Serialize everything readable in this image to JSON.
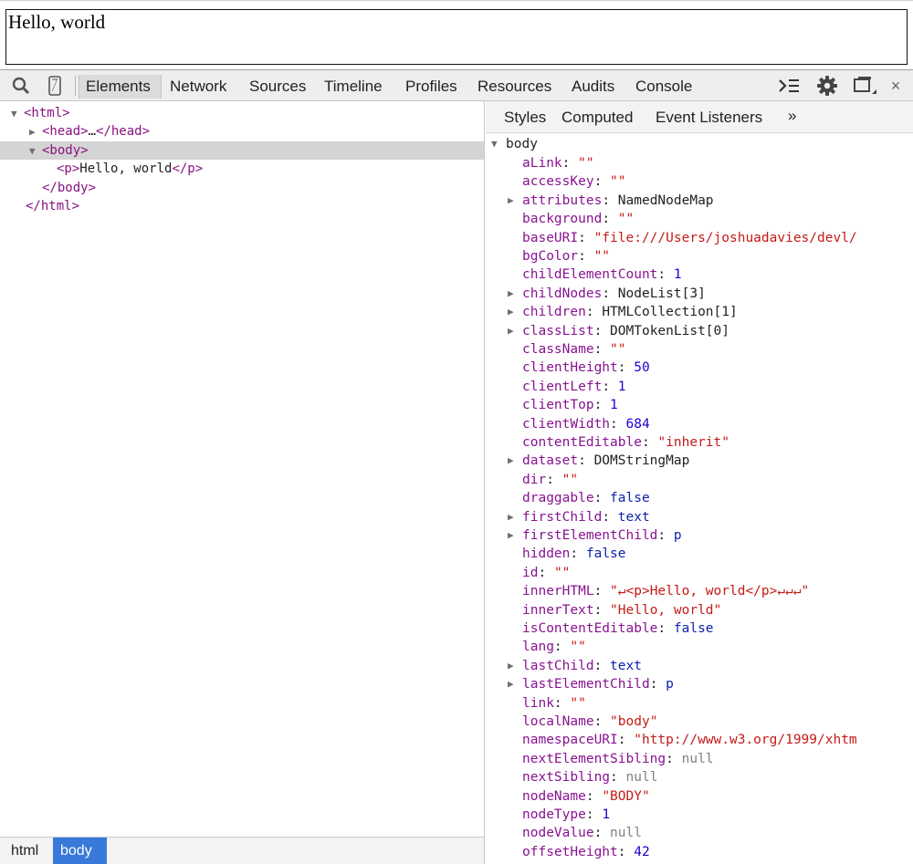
{
  "preview": {
    "text": "Hello, world"
  },
  "toolbar": {
    "tabs": [
      "Elements",
      "Network",
      "Sources",
      "Timeline",
      "Profiles",
      "Resources",
      "Audits",
      "Console"
    ],
    "active_tab": "Elements"
  },
  "elements_tree": {
    "html_open": "<html>",
    "head": "<head>",
    "head_ellipsis": "…",
    "head_close": "</head>",
    "body_open": "<body>",
    "p_open": "<p>",
    "p_text": "Hello, world",
    "p_close": "</p>",
    "body_close": "</body>",
    "html_close": "</html>"
  },
  "breadcrumbs": [
    "html",
    "body"
  ],
  "sidebar": {
    "tabs": [
      "Styles",
      "Computed",
      "Event Listeners"
    ],
    "more": "»",
    "object_name": "body",
    "properties": [
      {
        "key": "aLink",
        "value": "\"\"",
        "type": "string",
        "expandable": false
      },
      {
        "key": "accessKey",
        "value": "\"\"",
        "type": "string",
        "expandable": false
      },
      {
        "key": "attributes",
        "value": "NamedNodeMap",
        "type": "object",
        "expandable": true
      },
      {
        "key": "background",
        "value": "\"\"",
        "type": "string",
        "expandable": false
      },
      {
        "key": "baseURI",
        "value": "\"file:///Users/joshuadavies/devl/",
        "type": "string",
        "expandable": false
      },
      {
        "key": "bgColor",
        "value": "\"\"",
        "type": "string",
        "expandable": false
      },
      {
        "key": "childElementCount",
        "value": "1",
        "type": "number",
        "expandable": false
      },
      {
        "key": "childNodes",
        "value": "NodeList[3]",
        "type": "object",
        "expandable": true
      },
      {
        "key": "children",
        "value": "HTMLCollection[1]",
        "type": "object",
        "expandable": true
      },
      {
        "key": "classList",
        "value": "DOMTokenList[0]",
        "type": "object",
        "expandable": true
      },
      {
        "key": "className",
        "value": "\"\"",
        "type": "string",
        "expandable": false
      },
      {
        "key": "clientHeight",
        "value": "50",
        "type": "number",
        "expandable": false
      },
      {
        "key": "clientLeft",
        "value": "1",
        "type": "number",
        "expandable": false
      },
      {
        "key": "clientTop",
        "value": "1",
        "type": "number",
        "expandable": false
      },
      {
        "key": "clientWidth",
        "value": "684",
        "type": "number",
        "expandable": false
      },
      {
        "key": "contentEditable",
        "value": "\"inherit\"",
        "type": "string",
        "expandable": false
      },
      {
        "key": "dataset",
        "value": "DOMStringMap",
        "type": "object",
        "expandable": true
      },
      {
        "key": "dir",
        "value": "\"\"",
        "type": "string",
        "expandable": false
      },
      {
        "key": "draggable",
        "value": "false",
        "type": "boolean",
        "expandable": false
      },
      {
        "key": "firstChild",
        "value": "text",
        "type": "keyword",
        "expandable": true
      },
      {
        "key": "firstElementChild",
        "value": "p",
        "type": "keyword",
        "expandable": true
      },
      {
        "key": "hidden",
        "value": "false",
        "type": "boolean",
        "expandable": false
      },
      {
        "key": "id",
        "value": "\"\"",
        "type": "string",
        "expandable": false
      },
      {
        "key": "innerHTML",
        "value": "\"↵<p>Hello, world</p>↵↵↵\"",
        "type": "string",
        "expandable": false
      },
      {
        "key": "innerText",
        "value": "\"Hello, world\"",
        "type": "string",
        "expandable": false
      },
      {
        "key": "isContentEditable",
        "value": "false",
        "type": "boolean",
        "expandable": false
      },
      {
        "key": "lang",
        "value": "\"\"",
        "type": "string",
        "expandable": false
      },
      {
        "key": "lastChild",
        "value": "text",
        "type": "keyword",
        "expandable": true
      },
      {
        "key": "lastElementChild",
        "value": "p",
        "type": "keyword",
        "expandable": true
      },
      {
        "key": "link",
        "value": "\"\"",
        "type": "string",
        "expandable": false
      },
      {
        "key": "localName",
        "value": "\"body\"",
        "type": "string",
        "expandable": false
      },
      {
        "key": "namespaceURI",
        "value": "\"http://www.w3.org/1999/xhtm",
        "type": "string",
        "expandable": false
      },
      {
        "key": "nextElementSibling",
        "value": "null",
        "type": "null",
        "expandable": false
      },
      {
        "key": "nextSibling",
        "value": "null",
        "type": "null",
        "expandable": false
      },
      {
        "key": "nodeName",
        "value": "\"BODY\"",
        "type": "string",
        "expandable": false
      },
      {
        "key": "nodeType",
        "value": "1",
        "type": "number",
        "expandable": false
      },
      {
        "key": "nodeValue",
        "value": "null",
        "type": "null",
        "expandable": false
      },
      {
        "key": "offsetHeight",
        "value": "42",
        "type": "number",
        "expandable": false
      }
    ]
  },
  "colors": {
    "tag": "#881280",
    "property_key": "#881391",
    "string": "#c41a16",
    "number": "#1c00cf",
    "boolean": "#0d22aa",
    "null": "#808080",
    "selection": "#3879d9"
  },
  "icons": [
    "search-icon",
    "device-mode-icon",
    "console-drawer-icon",
    "gear-icon",
    "dock-icon",
    "close-icon",
    "expand-arrow-icon",
    "collapse-arrow-icon"
  ]
}
